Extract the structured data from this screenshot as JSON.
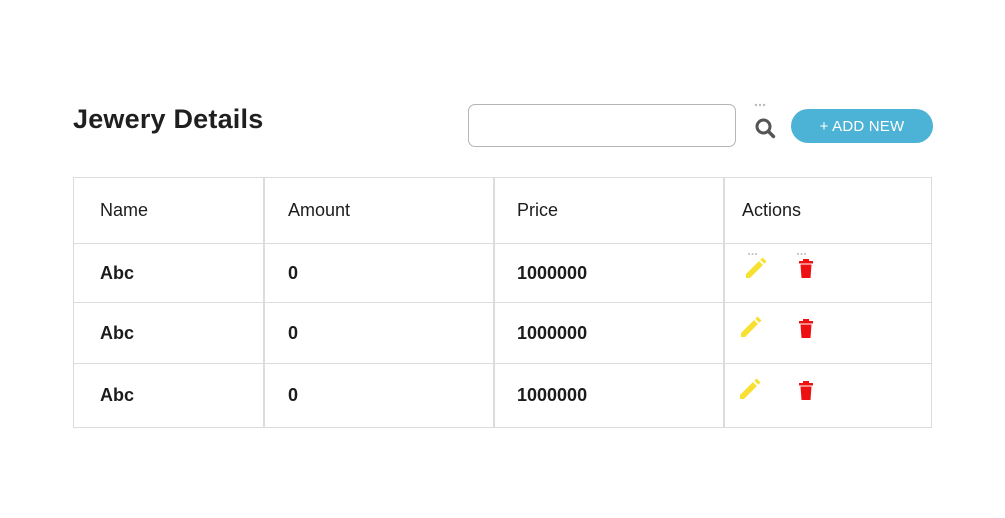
{
  "header": {
    "title": "Jewery Details",
    "search": {
      "value": "",
      "placeholder": ""
    },
    "add_label": "+ ADD NEW"
  },
  "table": {
    "columns": [
      "Name",
      "Amount",
      "Price",
      "Actions"
    ],
    "rows": [
      {
        "name": "Abc",
        "amount": "0",
        "price": "1000000"
      },
      {
        "name": "Abc",
        "amount": "0",
        "price": "1000000"
      },
      {
        "name": "Abc",
        "amount": "0",
        "price": "1000000"
      }
    ]
  },
  "icons": {
    "search": "search-icon",
    "edit": "pencil-icon",
    "delete": "trash-icon"
  },
  "colors": {
    "accent": "#4db3d6",
    "edit": "#f7e032",
    "delete": "#ee1111",
    "search_icon": "#555555",
    "border": "#dcdcdc"
  }
}
